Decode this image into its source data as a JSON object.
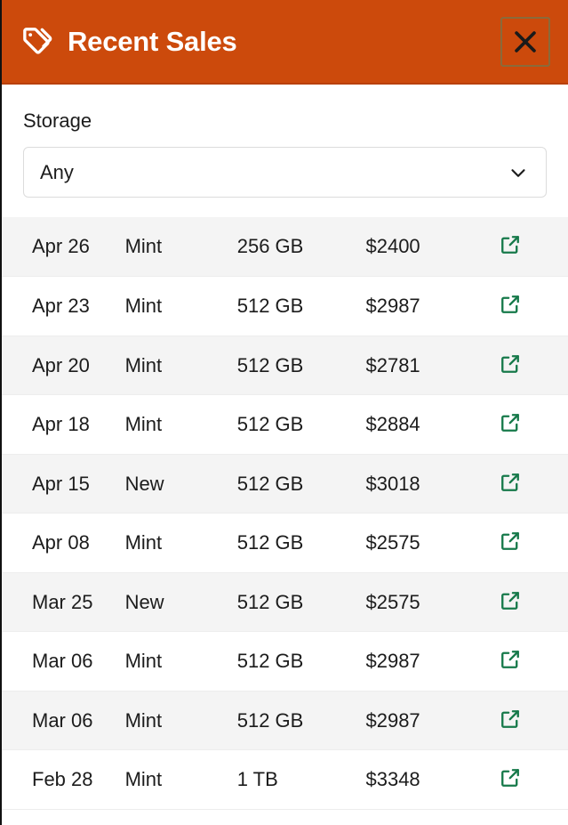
{
  "header": {
    "title": "Recent Sales",
    "tag_icon": "tag-icon",
    "close_icon": "close-icon",
    "close_label": "Close",
    "background_color": "#cc4a0c",
    "title_color": "#ffffff"
  },
  "filter": {
    "label": "Storage",
    "selected_value": "Any",
    "chevron_icon": "chevron-down-icon",
    "options": [
      "Any"
    ]
  },
  "table": {
    "columns": [
      "date",
      "condition",
      "storage",
      "price",
      "action"
    ],
    "action_icon": "external-link-icon",
    "action_color": "#16794a",
    "stripe_color": "#f4f4f4",
    "rows": [
      {
        "date": "Apr 26",
        "condition": "Mint",
        "storage": "256 GB",
        "price": "$2400"
      },
      {
        "date": "Apr 23",
        "condition": "Mint",
        "storage": "512 GB",
        "price": "$2987"
      },
      {
        "date": "Apr 20",
        "condition": "Mint",
        "storage": "512 GB",
        "price": "$2781"
      },
      {
        "date": "Apr 18",
        "condition": "Mint",
        "storage": "512 GB",
        "price": "$2884"
      },
      {
        "date": "Apr 15",
        "condition": "New",
        "storage": "512 GB",
        "price": "$3018"
      },
      {
        "date": "Apr 08",
        "condition": "Mint",
        "storage": "512 GB",
        "price": "$2575"
      },
      {
        "date": "Mar 25",
        "condition": "New",
        "storage": "512 GB",
        "price": "$2575"
      },
      {
        "date": "Mar 06",
        "condition": "Mint",
        "storage": "512 GB",
        "price": "$2987"
      },
      {
        "date": "Mar 06",
        "condition": "Mint",
        "storage": "512 GB",
        "price": "$2987"
      },
      {
        "date": "Feb 28",
        "condition": "Mint",
        "storage": "1 TB",
        "price": "$3348"
      }
    ]
  }
}
